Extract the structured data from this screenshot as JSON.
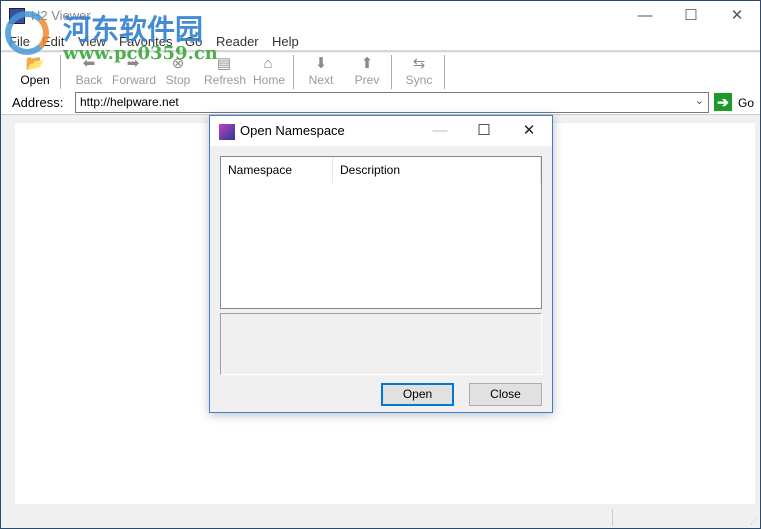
{
  "window": {
    "title": "H2 Viewer",
    "minimize": "—",
    "maximize": "☐",
    "close": "✕"
  },
  "watermark": {
    "site_name": "河东软件园",
    "url": "www.pc0359.cn"
  },
  "menu": [
    "File",
    "Edit",
    "View",
    "Favorites",
    "Go",
    "Reader",
    "Help"
  ],
  "toolbar": [
    {
      "label": "Open",
      "icon": "open-icon",
      "glyph": "📂"
    },
    {
      "label": "Back",
      "icon": "back-arrow-icon",
      "glyph": "⬅"
    },
    {
      "label": "Forward",
      "icon": "forward-arrow-icon",
      "glyph": "➡"
    },
    {
      "label": "Stop",
      "icon": "stop-icon",
      "glyph": "⊗"
    },
    {
      "label": "Refresh",
      "icon": "refresh-icon",
      "glyph": "▤"
    },
    {
      "label": "Home",
      "icon": "home-icon",
      "glyph": "⌂"
    },
    {
      "label": "Next",
      "icon": "down-arrow-icon",
      "glyph": "⬇"
    },
    {
      "label": "Prev",
      "icon": "up-arrow-icon",
      "glyph": "⬆"
    },
    {
      "label": "Sync",
      "icon": "sync-icon",
      "glyph": "⇆"
    }
  ],
  "address": {
    "label": "Address:",
    "value": "http://helpware.net",
    "go_label": "Go",
    "go_glyph": "➔",
    "dropdown_glyph": "⌄"
  },
  "dialog": {
    "title": "Open Namespace",
    "minimize": "—",
    "maximize": "☐",
    "close": "✕",
    "columns": [
      "Namespace",
      "Description"
    ],
    "open_button": "Open",
    "close_button": "Close"
  }
}
